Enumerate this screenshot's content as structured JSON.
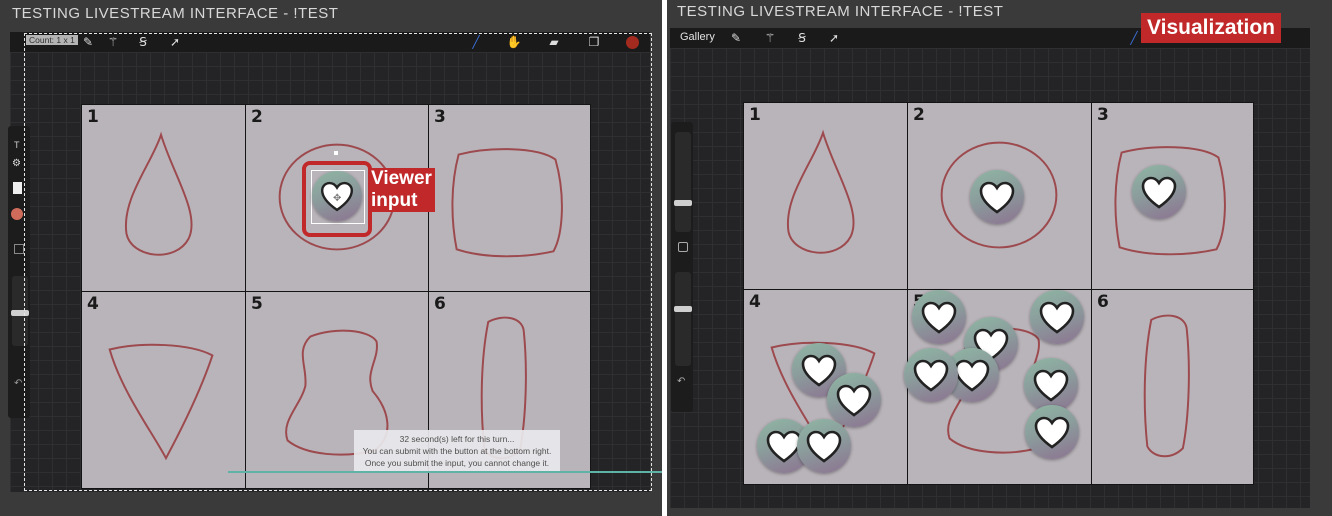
{
  "left_panel": {
    "title": "TESTING LIVESTREAM INTERFACE - !TEST",
    "count_label": "Count: 1 x 1",
    "cells": [
      "1",
      "2",
      "3",
      "4",
      "5",
      "6"
    ],
    "viewer_label_line1": "Viewer",
    "viewer_label_line2": "input",
    "tooltip": {
      "line1": "32 second(s) left for this turn...",
      "line2": "You can submit with the button at the bottom right.",
      "line3": "Once you submit the input, you cannot change it."
    }
  },
  "right_panel": {
    "title": "TESTING LIVESTREAM INTERFACE - !TEST",
    "gallery_label": "Gallery",
    "visualization_label": "Visualization",
    "cells": [
      "1",
      "2",
      "3",
      "4",
      "5",
      "6"
    ]
  },
  "icons": {
    "wrench": "wrench-icon",
    "magic": "magic-wand-icon",
    "selection": "selection-icon",
    "transform": "transform-arrow-icon",
    "brush": "brush-icon",
    "smudge": "smudge-icon",
    "eraser": "eraser-icon",
    "layers": "layers-icon",
    "color": "color-swatch-icon",
    "heart": "heart-icon"
  },
  "colors": {
    "accent_red": "#c0282a",
    "brush_blue": "#3b6fd6",
    "color_swatch": "#a32a1e",
    "board": "#b9b4ba",
    "progress": "#5fb3a6"
  }
}
